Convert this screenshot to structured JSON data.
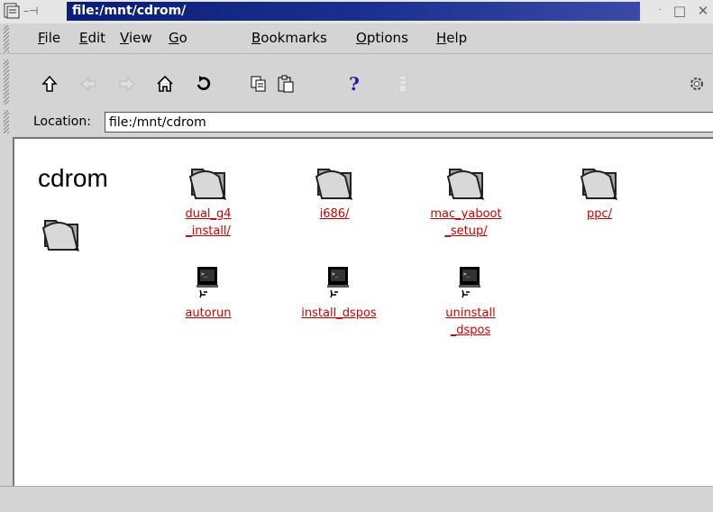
{
  "window": {
    "title": "file:/mnt/cdrom/"
  },
  "menu": [
    {
      "label": "File"
    },
    {
      "label": "Edit"
    },
    {
      "label": "View"
    },
    {
      "label": "Go"
    },
    {
      "label": "Bookmarks"
    },
    {
      "label": "Options"
    },
    {
      "label": "Help"
    }
  ],
  "location": {
    "label": "Location:",
    "value": "file:/mnt/cdrom"
  },
  "content": {
    "heading": "cdrom",
    "folders": [
      {
        "label": "dual_g4\n_install/"
      },
      {
        "label": "i686/"
      },
      {
        "label": "mac_yaboot\n_setup/"
      },
      {
        "label": "ppc/"
      }
    ],
    "scripts": [
      {
        "label": "autorun"
      },
      {
        "label": "install_dspos"
      },
      {
        "label": "uninstall\n_dspos"
      }
    ]
  },
  "icons": {
    "up": "up-arrow-icon",
    "back": "back-arrow-icon",
    "forward": "forward-arrow-icon",
    "home": "home-icon",
    "reload": "reload-icon",
    "copy": "copy-icon",
    "paste": "paste-icon",
    "help": "help-icon",
    "stop": "stop-icon",
    "busy": "gear-icon"
  }
}
